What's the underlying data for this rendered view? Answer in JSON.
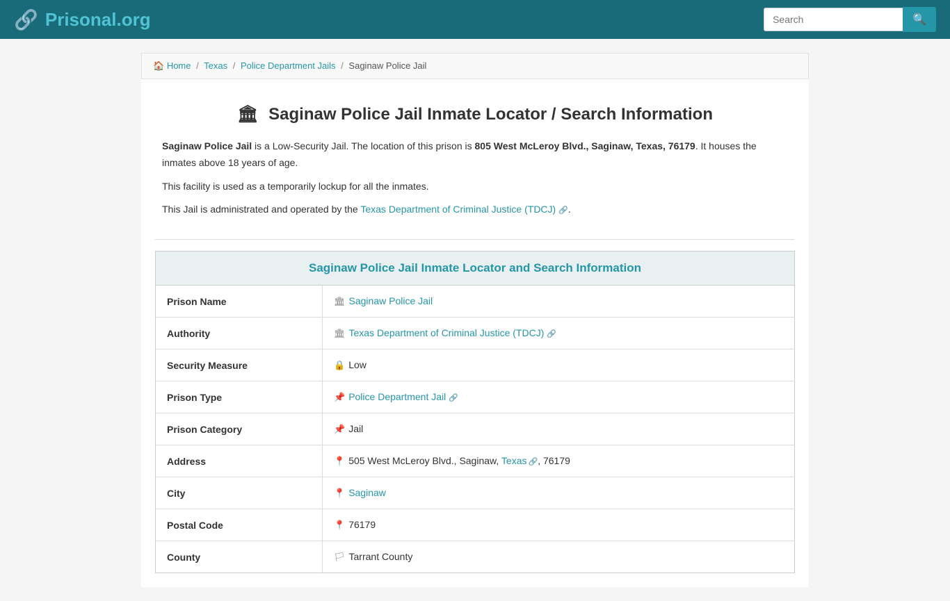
{
  "header": {
    "logo_text": "Prisonal",
    "logo_domain": ".org",
    "search_placeholder": "Search"
  },
  "breadcrumb": {
    "home": "Home",
    "state": "Texas",
    "category": "Police Department Jails",
    "current": "Saginaw Police Jail"
  },
  "page_title": "Saginaw Police Jail Inmate Locator / Search Information",
  "description": {
    "line1_prefix": "Saginaw Police Jail",
    "line1_mid": " is a Low-Security Jail. The location of this prison is ",
    "line1_address": "805 West McLeroy Blvd., Saginaw, Texas, 76179",
    "line1_suffix": ". It houses the inmates above 18 years of age.",
    "line2": "This facility is used as a temporarily lockup for all the inmates.",
    "line3_prefix": "This Jail is administrated and operated by the ",
    "line3_link": "Texas Department of Criminal Justice (TDCJ)",
    "line3_suffix": "."
  },
  "info_section_title": "Saginaw Police Jail Inmate Locator and Search Information",
  "table": {
    "rows": [
      {
        "label": "Prison Name",
        "value": "Saginaw Police Jail",
        "icon": "🏛",
        "is_link": true
      },
      {
        "label": "Authority",
        "value": "Texas Department of Criminal Justice (TDCJ)",
        "icon": "🏛",
        "is_link": true,
        "has_external": true
      },
      {
        "label": "Security Measure",
        "value": "Low",
        "icon": "🔒",
        "is_link": false
      },
      {
        "label": "Prison Type",
        "value": "Police Department Jail",
        "icon": "📌",
        "is_link": true,
        "has_external": true
      },
      {
        "label": "Prison Category",
        "value": "Jail",
        "icon": "📌",
        "is_link": false
      },
      {
        "label": "Address",
        "value": "505 West McLeroy Blvd., Saginaw, Texas",
        "value2": ", 76179",
        "icon": "📍",
        "is_link": false,
        "state_link": "Texas"
      },
      {
        "label": "City",
        "value": "Saginaw",
        "icon": "📍",
        "is_link": true
      },
      {
        "label": "Postal Code",
        "value": "76179",
        "icon": "📍",
        "is_link": false
      },
      {
        "label": "County",
        "value": "Tarrant County",
        "icon": "🏳",
        "is_link": false
      }
    ]
  }
}
